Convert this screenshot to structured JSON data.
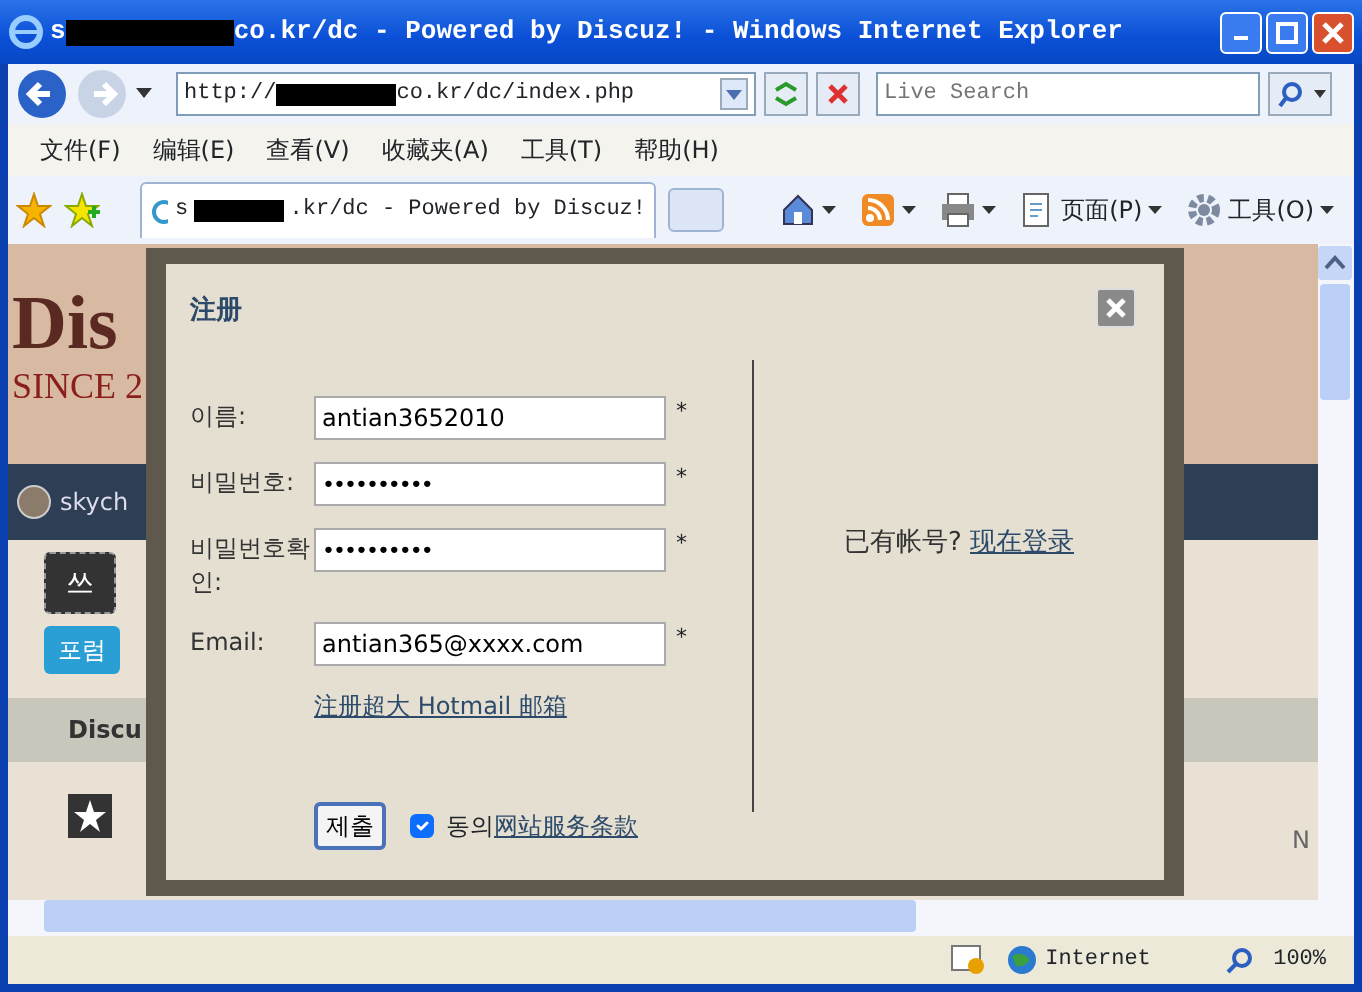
{
  "window": {
    "title_before": "s",
    "title_after": "co.kr/dc - Powered by Discuz! - Windows Internet Explorer"
  },
  "address_bar": {
    "before": "http://",
    "after": "co.kr/dc/index.php"
  },
  "search": {
    "placeholder": "Live Search"
  },
  "menu": [
    "文件(F)",
    "编辑(E)",
    "查看(V)",
    "收藏夹(A)",
    "工具(T)",
    "帮助(H)"
  ],
  "tab": {
    "before": "s",
    "after": ".kr/dc - Powered by Discuz!",
    "selected": true
  },
  "command_bar": [
    {
      "kind": "home"
    },
    {
      "kind": "feed"
    },
    {
      "kind": "print"
    },
    {
      "kind": "page",
      "label": "页面(P)"
    },
    {
      "kind": "tools",
      "label": "工具(O)"
    }
  ],
  "page": {
    "logo": "Dis",
    "since": "SINCE 2",
    "user": "skych",
    "write_button": "쓰",
    "forum_badge": "포럼",
    "section": "Discu",
    "side_letter": "N"
  },
  "dialog": {
    "title": "注册",
    "fields": [
      {
        "label": "이름:",
        "value": "antian3652010",
        "kind": "text",
        "mark": "*"
      },
      {
        "label": "비밀번호:",
        "value": "••••••••••",
        "kind": "password",
        "mark": "*"
      },
      {
        "label": "비밀번호확인:",
        "value": "••••••••••",
        "kind": "password",
        "mark": "*"
      },
      {
        "label": "Email:",
        "value": "antian365@xxxx.com",
        "kind": "text",
        "mark": "*"
      }
    ],
    "hotmail_link": "注册超大 Hotmail 邮箱",
    "submit": "제출",
    "agree": {
      "checked": true,
      "text": "동의",
      "link": "网站服务条款"
    },
    "login_prompt": "已有帐号?",
    "login_link": "现在登录"
  },
  "status_bar": {
    "zone": "Internet",
    "zoom": "100%"
  }
}
